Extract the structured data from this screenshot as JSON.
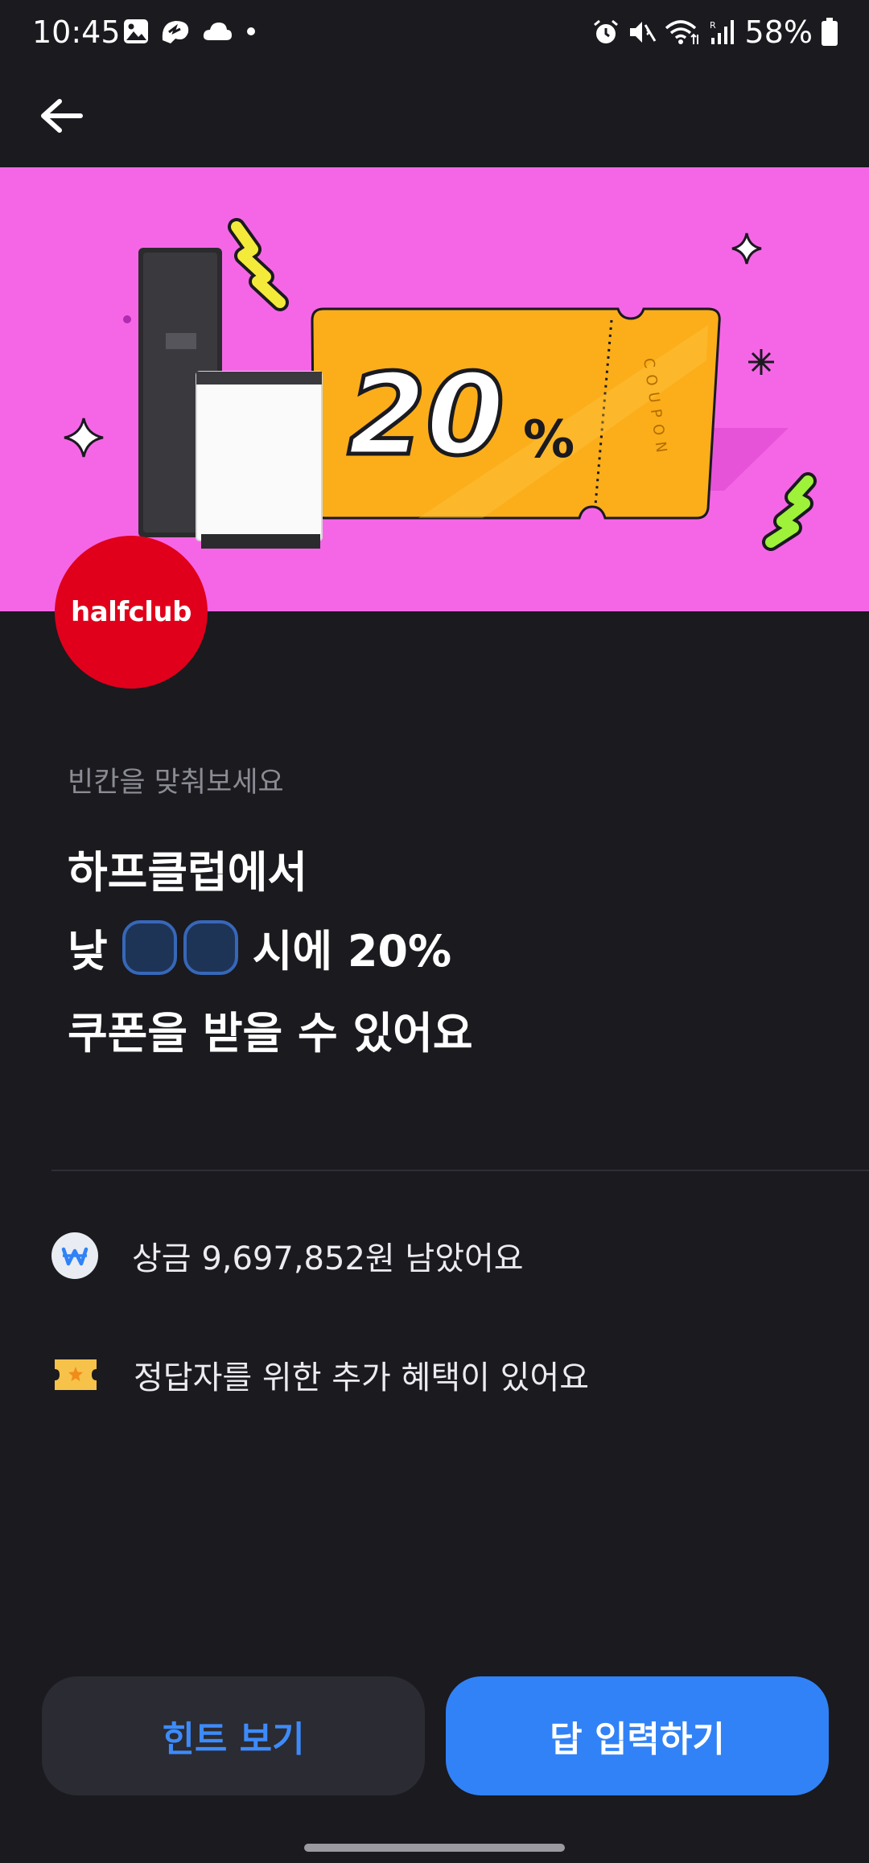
{
  "status_bar": {
    "time": "10:45",
    "battery_percent": "58%",
    "icons_left": [
      "gallery-icon",
      "thread-icon",
      "cloud-icon",
      "dot-icon"
    ],
    "icons_right": [
      "alarm-icon",
      "mute-icon",
      "wifi-icon",
      "signal-icon",
      "battery-icon"
    ]
  },
  "header": {
    "back_icon": "arrow-left-icon"
  },
  "banner": {
    "background_color": "#f566e6",
    "coupon_value": "20",
    "coupon_unit": "%",
    "coupon_stub_text": "COUPON"
  },
  "brand": {
    "logo_text": "halfclub",
    "color": "#e0001b"
  },
  "quiz": {
    "label": "빈칸을 맞춰보세요",
    "line1": "하프클럽에서",
    "line2_prefix": "낮",
    "line2_suffix": "시에 20%",
    "line3": "쿠폰을 받을 수 있어요",
    "blank_count": 2
  },
  "info": {
    "prize_text": "상금 9,697,852원 남았어요",
    "bonus_text": "정답자를 위한 추가 혜택이 있어요"
  },
  "buttons": {
    "hint_label": "힌트 보기",
    "answer_label": "답 입력하기"
  },
  "colors": {
    "accent": "#3182f6",
    "background": "#1a1a1f"
  }
}
